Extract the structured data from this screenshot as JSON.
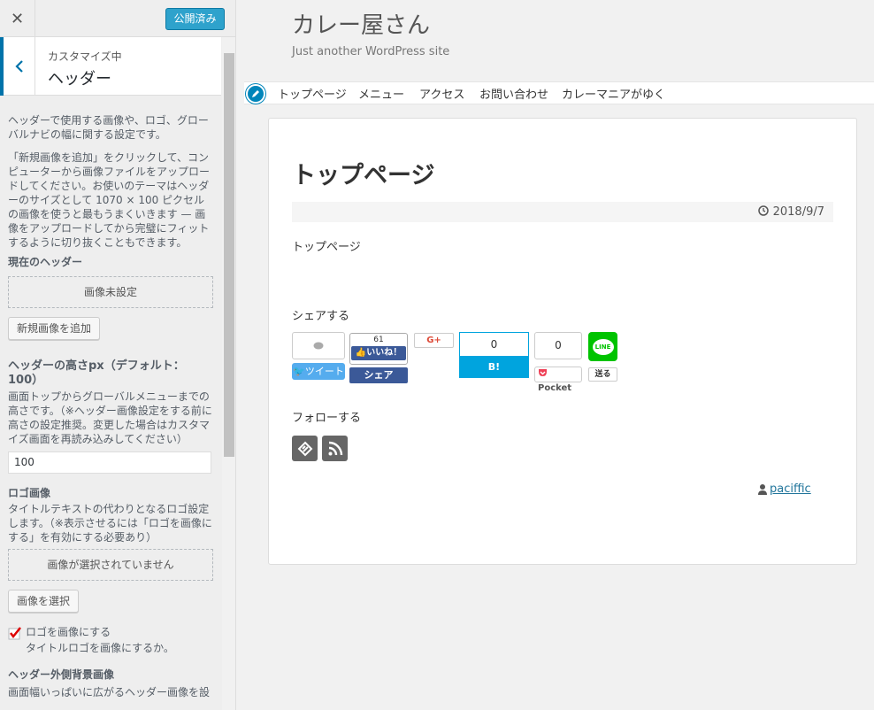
{
  "sidebar": {
    "close_label": "✕",
    "publish_label": "公開済み",
    "back_label": "‹",
    "breadcrumb": "カスタマイズ中",
    "section_title": "ヘッダー",
    "desc1": "ヘッダーで使用する画像や、ロゴ、グローバルナビの幅に関する設定です。",
    "desc2": "「新規画像を追加」をクリックして、コンピューターから画像ファイルをアップロードしてください。お使いのテーマはヘッダーのサイズとして 1070 × 100 ピクセルの画像を使うと最もうまくいきます — 画像をアップロードしてから完璧にフィットするように切り抜くこともできます。",
    "current_header_label": "現在のヘッダー",
    "no_image": "画像未設定",
    "add_image_button": "新規画像を追加",
    "height_label": "ヘッダーの高さpx（デフォルト：100）",
    "height_desc": "画面トップからグローバルメニューまでの高さです。（※ヘッダー画像設定をする前に高さの設定推奨。変更した場合はカスタマイズ画面を再読み込みしてください）",
    "height_value": "100",
    "logo_label": "ロゴ画像",
    "logo_desc": "タイトルテキストの代わりとなるロゴ設定します。（※表示させるには「ロゴを画像にする」を有効にする必要あり）",
    "logo_none": "画像が選択されていません",
    "select_image_button": "画像を選択",
    "logo_checkbox_label": "ロゴを画像にする",
    "logo_checkbox_desc": "タイトルロゴを画像にするか。",
    "outer_bg_label": "ヘッダー外側背景画像",
    "outer_bg_desc": "画面幅いっぱいに広がるヘッダー画像を設"
  },
  "site": {
    "title": "カレー屋さん",
    "tagline": "Just another WordPress site",
    "nav": [
      "トップページ",
      "メニュー",
      "アクセス",
      "お問い合わせ",
      "カレーマニアがゆく"
    ],
    "post_title": "トップページ",
    "date": "2018/9/7",
    "body": "トップページ",
    "share_heading": "シェアする",
    "follow_heading": "フォローする",
    "author": "paciffic"
  },
  "share": {
    "twitter_label": "ツイート",
    "fb_count": "61",
    "fb_like": "いいね！",
    "fb_share": "シェア",
    "gplus": "G+",
    "hatena_count": "0",
    "hatena_label": "B! Bookmark",
    "pocket_count": "0",
    "pocket_label": "Pocket",
    "line_label": "LINE",
    "line_send": "送る"
  },
  "colors": {
    "accent": "#0073aa",
    "publish": "#2ea2cc",
    "twitter": "#55acee",
    "facebook": "#3b5998",
    "hatena": "#00a4de",
    "pocket": "#ef4056",
    "line": "#00c300"
  }
}
